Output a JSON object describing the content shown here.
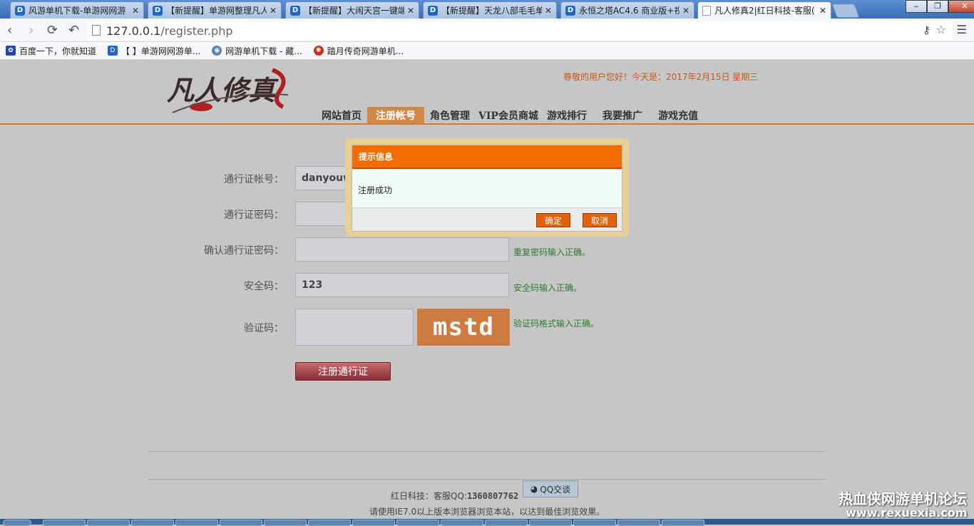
{
  "browser": {
    "tabs": [
      {
        "label": "风游单机下载-单游网网游",
        "fav": "D"
      },
      {
        "label": "【新提醒】单游网整理凡人",
        "fav": "D"
      },
      {
        "label": "【新提醒】大闹天宫一键端",
        "fav": "D"
      },
      {
        "label": "【新提醒】天龙八部毛毛单",
        "fav": "D"
      },
      {
        "label": "永恒之塔AC4.6 商业版+视",
        "fav": "D"
      },
      {
        "label": "凡人修真2|红日科技-客服(",
        "fav": ""
      }
    ],
    "url_host": "127.0.0.1",
    "url_path": "/register.php",
    "bookmarks": [
      {
        "label": "百度一下，你就知道",
        "icon": "paw-icon"
      },
      {
        "label": "【 】单游网网游单...",
        "icon": "d-icon"
      },
      {
        "label": "网游单机下载 - 藏...",
        "icon": "globe-icon"
      },
      {
        "label": "踏月传奇网游单机...",
        "icon": "red-icon"
      }
    ]
  },
  "site": {
    "greeting": "尊敬的用户您好！今天是：2017年2月15日 星期三",
    "logo_text": "凡人修真",
    "nav": [
      "网站首页",
      "注册帐号",
      "角色管理",
      "VIP会员商城",
      "游戏排行",
      "我要推广",
      "游戏充值"
    ]
  },
  "form": {
    "account_label": "通行证帐号：",
    "account_value": "danyouwa",
    "password_label": "通行证密码：",
    "confirm_label": "确认通行证密码：",
    "confirm_hint": "重复密码输入正确。",
    "security_label": "安全码：",
    "security_value": "123",
    "security_hint": "安全码输入正确。",
    "captcha_label": "验证码：",
    "captcha_text": "mstd",
    "captcha_hint": "验证码格式输入正确。",
    "submit_label": "注册通行证"
  },
  "footer": {
    "company": "红日科技：客服QQ:",
    "qq": "1360807762",
    "qq_button": "QQ交谈",
    "browser_note": "请使用IE7.0以上版本浏览器浏览本站，以达到最佳浏览效果。",
    "watermark_title": "热血侠网游单机论坛",
    "watermark_url": "www.rexuexia.com"
  },
  "dialog": {
    "title": "提示信息",
    "message": "注册成功",
    "ok": "确定",
    "cancel": "取消"
  }
}
